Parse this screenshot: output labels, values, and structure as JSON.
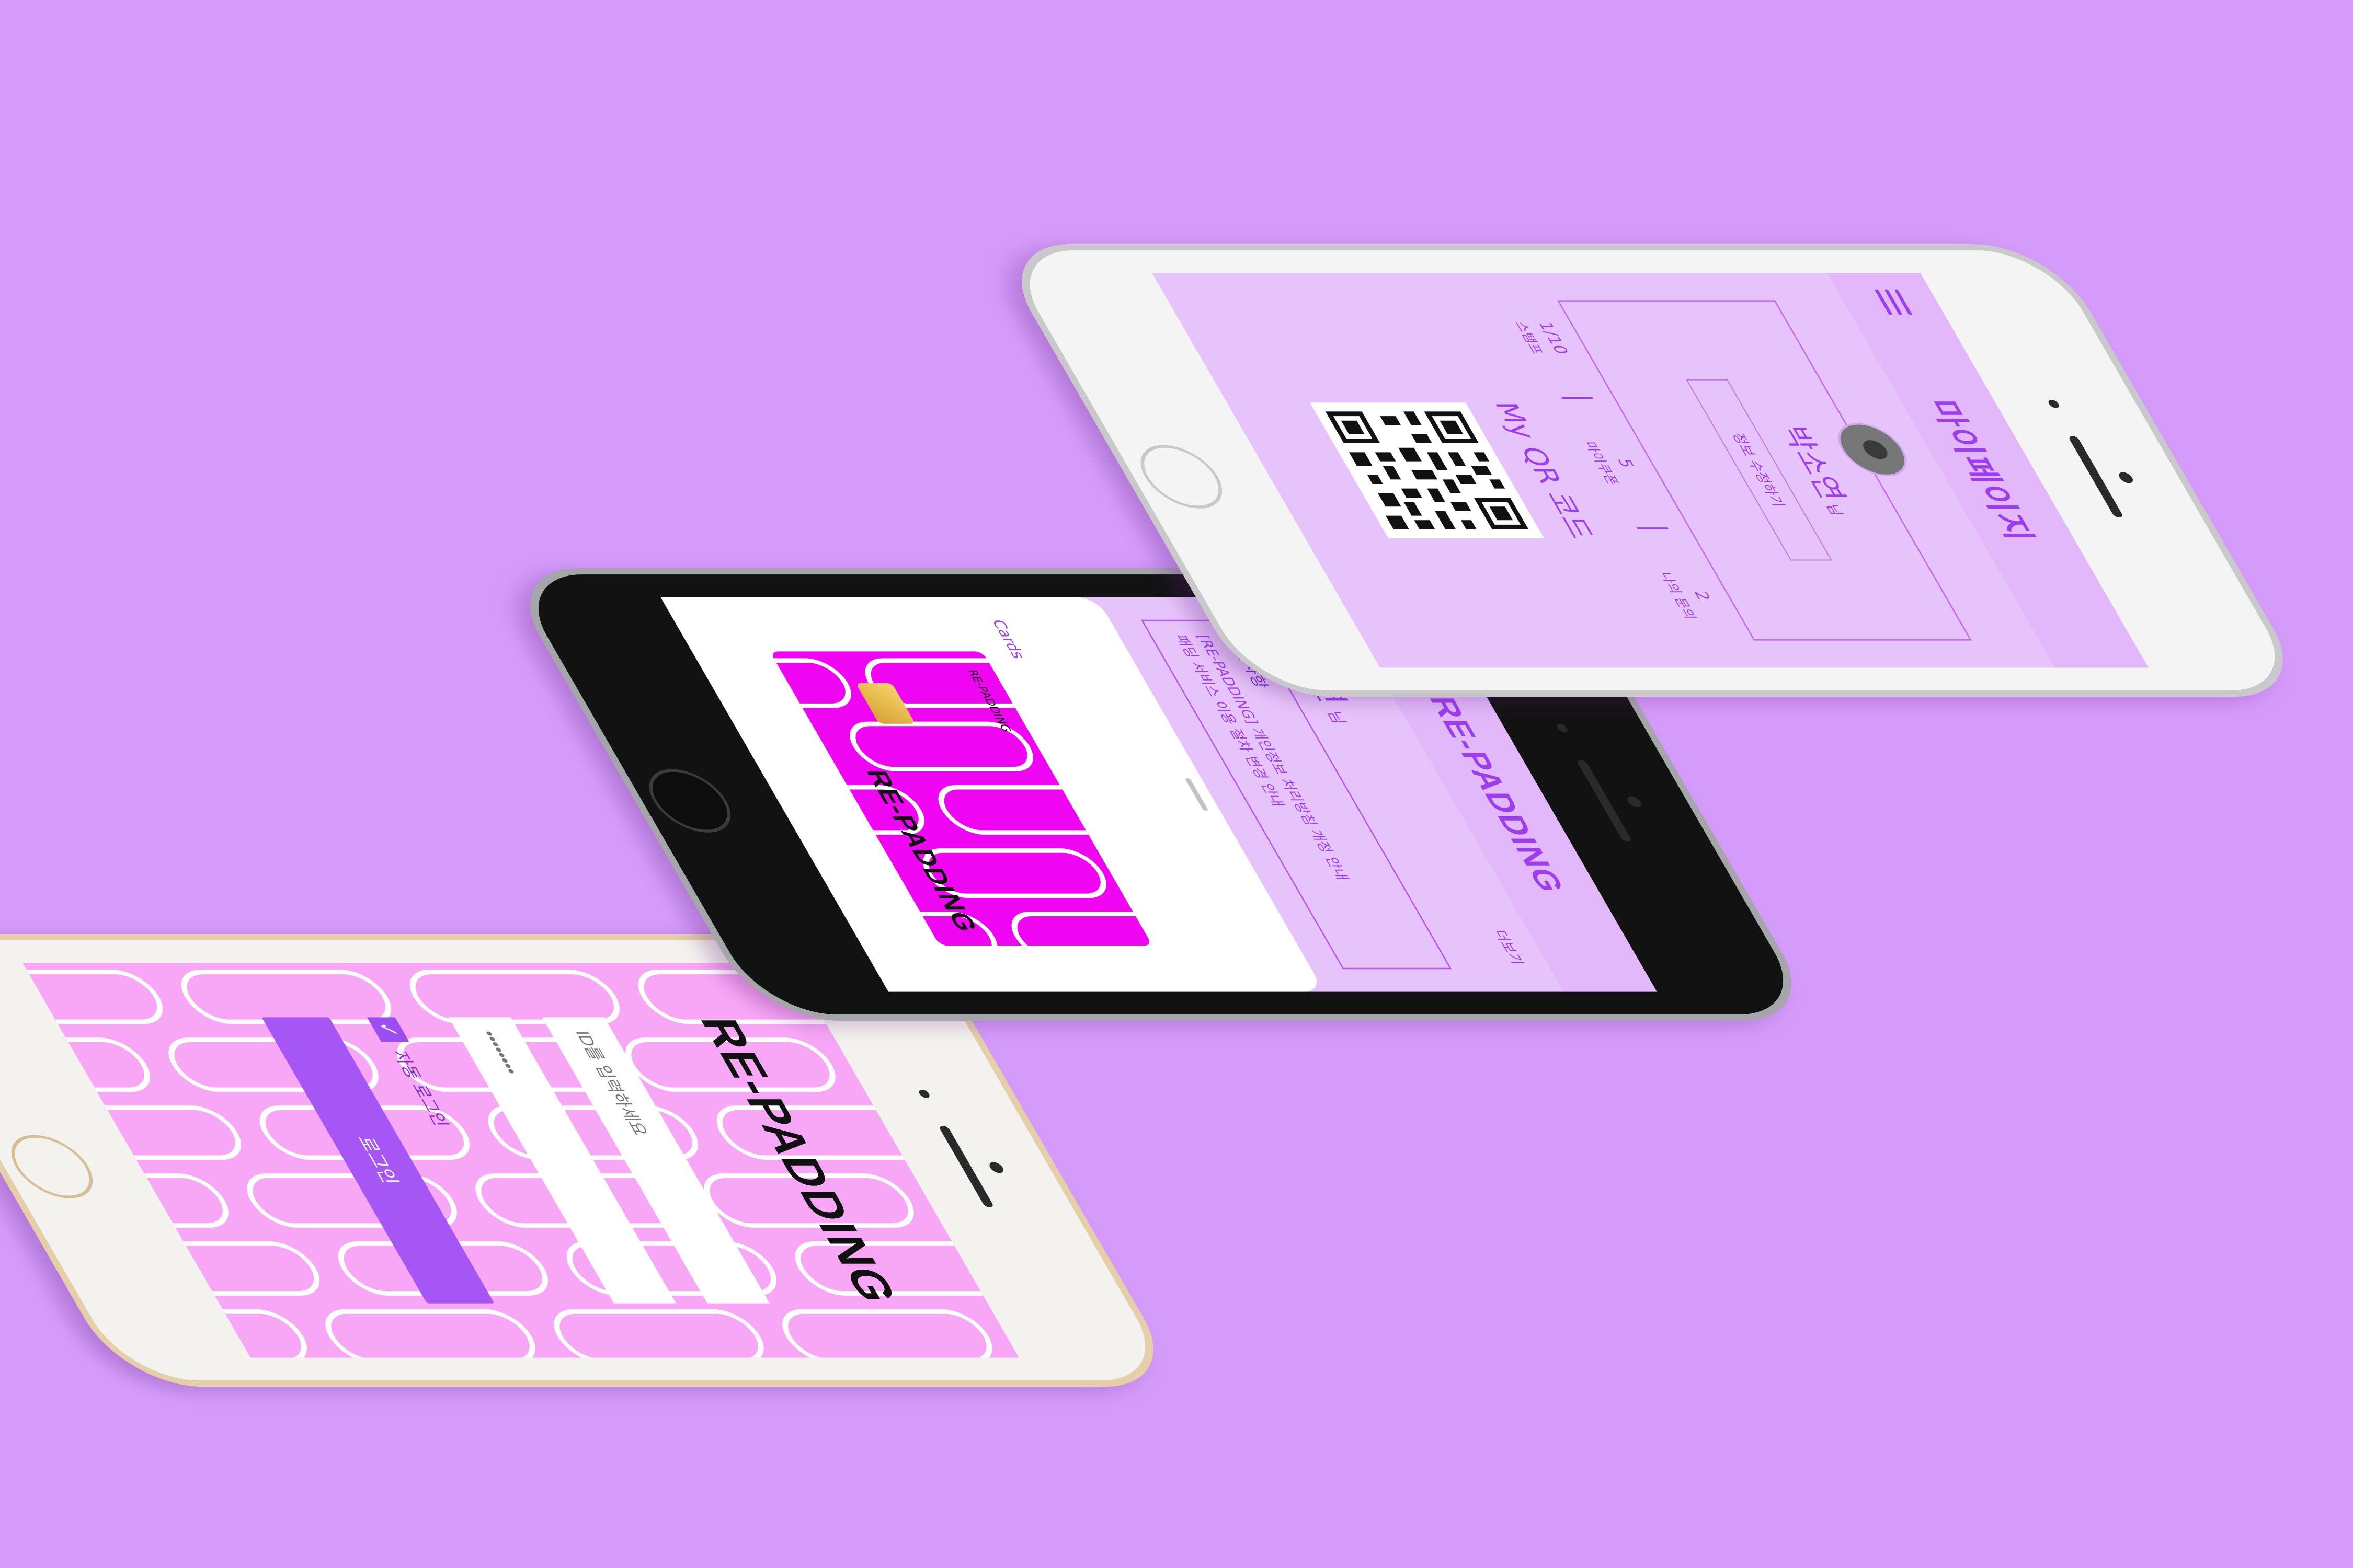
{
  "colors": {
    "background": "#d69cfc",
    "accent": "#9c3df0",
    "card": "#ef05f2",
    "pattern_bg": "#f8a6f6"
  },
  "login_screen": {
    "logo": "RE-PADDING",
    "id_placeholder": "ID를 입력하세요",
    "password_placeholder": "••••••••",
    "auto_login_label": "자동 로그인",
    "login_button": "로그인"
  },
  "main_screen": {
    "app_title": "RE-PADDING",
    "menu_icon": "hamburger-icon",
    "user_name": "박소연",
    "user_suffix": "님",
    "more_link": "더보기",
    "notice": {
      "heading": "공지사항",
      "line1": "[RE-PADDING] 개인정보 처리방침 개정 안내",
      "line2": "패딩 서비스 이용 절차 변경 안내"
    },
    "cards_label": "Cards",
    "card": {
      "logo": "RE-PADDING",
      "small_text": "RE-PADDING"
    }
  },
  "mypage_screen": {
    "title": "마이페이지",
    "menu_icon": "hamburger-icon",
    "user_name": "박소연",
    "user_suffix": "님",
    "edit_button": "정보 수정하기",
    "stats": [
      {
        "value": "1/10",
        "label": "스탬프"
      },
      {
        "value": "5",
        "label": "마이쿠폰"
      },
      {
        "value": "2",
        "label": "나의 문의"
      }
    ],
    "qr_title": "My QR 코드",
    "qr_icon": "qr-code-icon"
  }
}
